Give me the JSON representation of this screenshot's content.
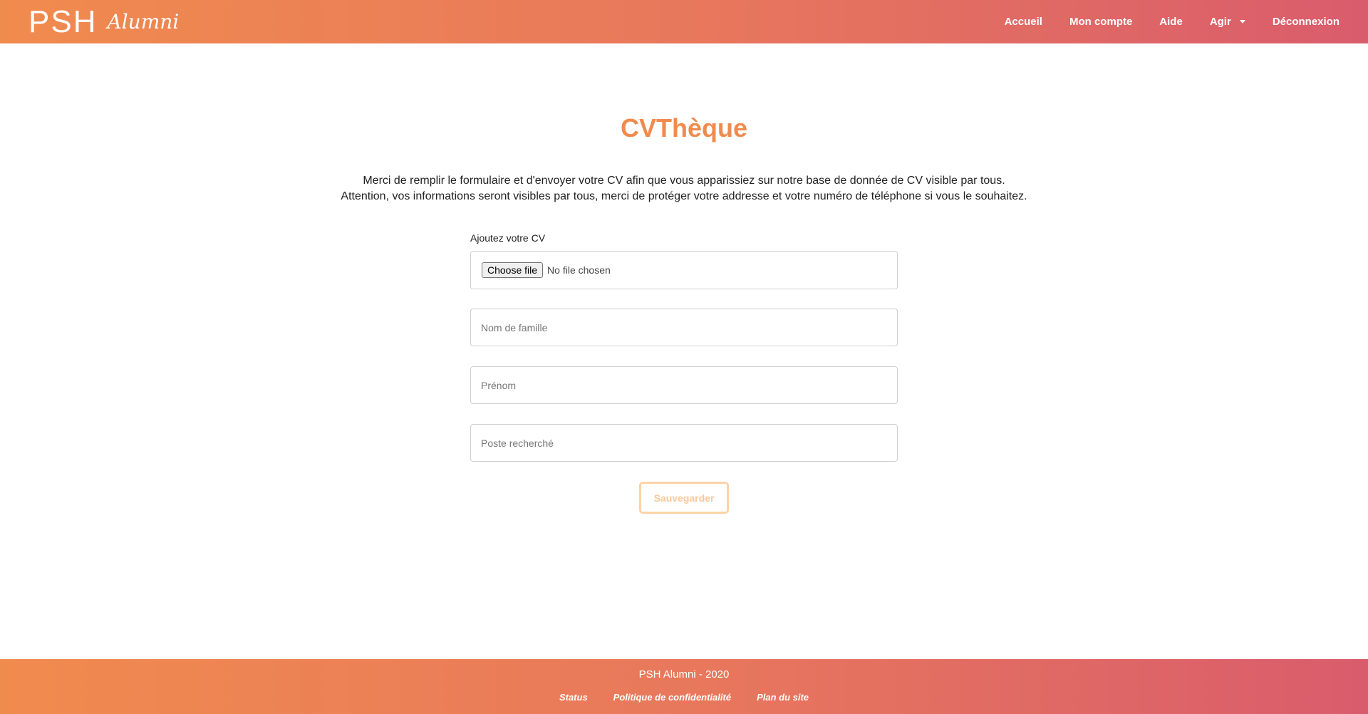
{
  "header": {
    "logo_text": "PSH",
    "logo_script": "Alumni",
    "nav": [
      {
        "label": "Accueil"
      },
      {
        "label": "Mon compte"
      },
      {
        "label": "Aide"
      },
      {
        "label": "Agir"
      },
      {
        "label": "Déconnexion"
      }
    ]
  },
  "main": {
    "title": "CVThèque",
    "intro_line1": "Merci de remplir le formulaire et d'envoyer votre CV afin que vous apparissiez sur notre base de donnée de CV visible par tous.",
    "intro_line2": "Attention, vos informations seront visibles par tous, merci de protéger votre addresse et votre numéro de téléphone si vous le souhaitez.",
    "form": {
      "cv_label": "Ajoutez votre CV",
      "file_button": "Choose file",
      "file_status": "No file chosen",
      "last_name_placeholder": "Nom de famille",
      "first_name_placeholder": "Prénom",
      "position_placeholder": "Poste recherché",
      "submit_label": "Sauvegarder"
    }
  },
  "footer": {
    "copyright": "PSH Alumni - 2020",
    "links": [
      {
        "label": "Status"
      },
      {
        "label": "Politique de confidentialité"
      },
      {
        "label": "Plan du site"
      }
    ]
  },
  "colors": {
    "brand_orange": "#f08b4e",
    "brand_pink": "#d95c6c"
  }
}
